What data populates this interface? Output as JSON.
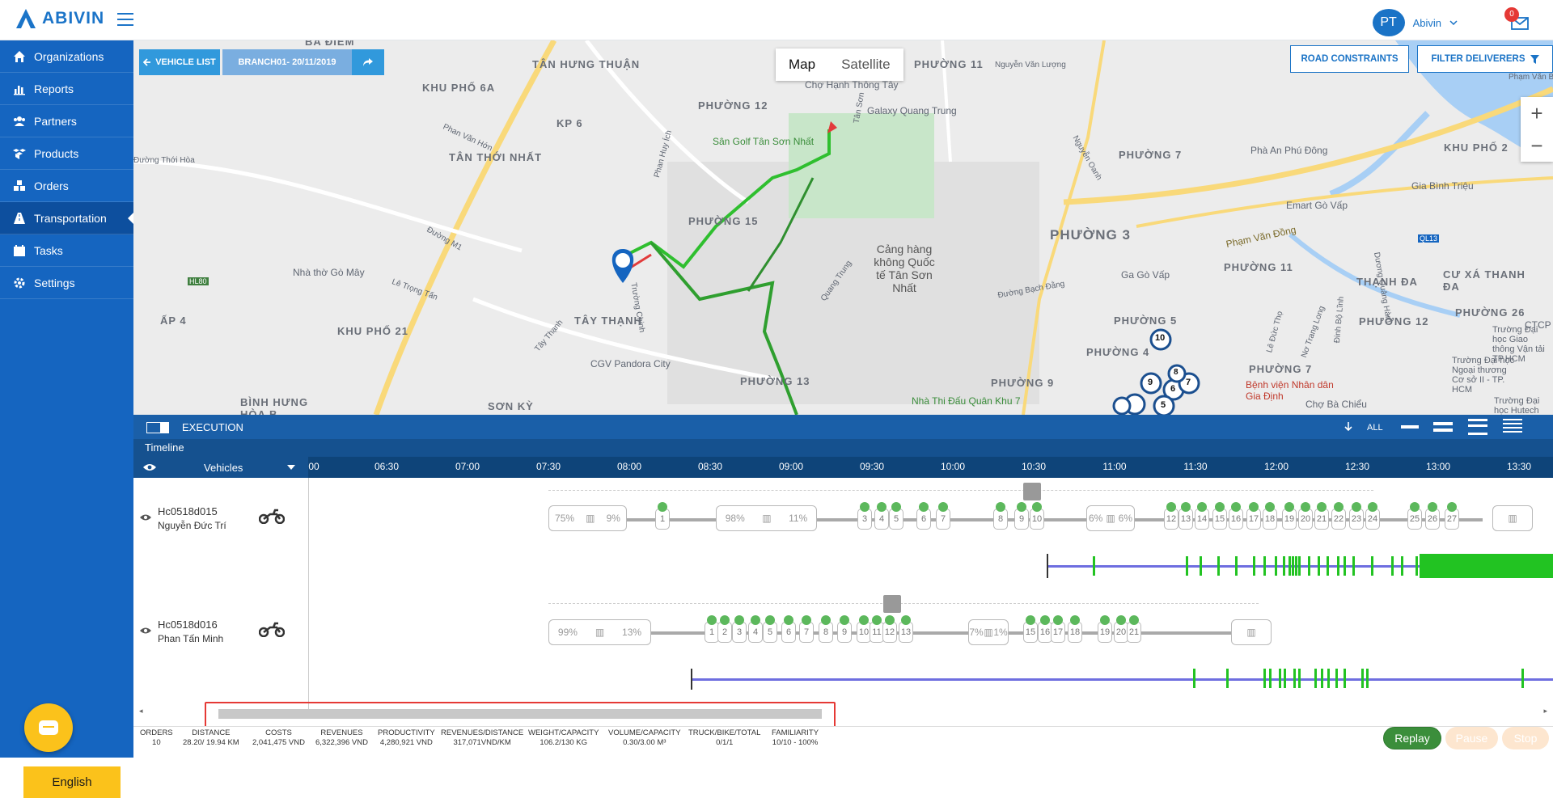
{
  "app": {
    "logo_text": "ABIVIN"
  },
  "topbar": {
    "avatar_initials": "PT",
    "user_name": "Abivin",
    "notification_count": "0"
  },
  "sidebar": {
    "items": [
      {
        "label": "Organizations",
        "icon": "home-icon"
      },
      {
        "label": "Reports",
        "icon": "bar-chart-icon"
      },
      {
        "label": "Partners",
        "icon": "users-icon"
      },
      {
        "label": "Products",
        "icon": "boxes-icon"
      },
      {
        "label": "Orders",
        "icon": "cubes-icon"
      },
      {
        "label": "Transportation",
        "icon": "road-icon",
        "active": true
      },
      {
        "label": "Tasks",
        "icon": "calendar-icon"
      },
      {
        "label": "Settings",
        "icon": "gear-icon"
      }
    ],
    "language": "English"
  },
  "map": {
    "vehicle_list_label": "VEHICLE LIST",
    "branch_label": "BRANCH01- 20/11/2019",
    "map_type_map": "Map",
    "map_type_satellite": "Satellite",
    "road_constraints_label": "ROAD CONSTRAINTS",
    "filter_deliverers_label": "FILTER DELIVERERS",
    "zoom_in": "+",
    "zoom_out": "−",
    "labels": [
      "BA ĐIỂM",
      "TÂN HƯNG THUẬN",
      "KHU PHỐ 6A",
      "KP 6",
      "TÂN THỚI NHẤT",
      "PHƯỜNG 12",
      "PHƯỜNG 15",
      "Sân Golf Tân Sơn Nhất",
      "Chợ Hạnh Thông Tây",
      "Galaxy Quang Trung",
      "PHƯỜNG 11",
      "PHƯỜNG 7",
      "Phà An Phú Đông",
      "KHU PHỐ 2",
      "Gia Bình Triệu",
      "Emart Gò Vấp",
      "PHƯỜNG 3",
      "Cảng hàng không Quốc tế Tân Sơn Nhất",
      "Phạm Văn Đồng",
      "Ga Gò Vấp",
      "PHƯỜNG 11",
      "THẠNH ĐA",
      "CƯ XÁ THANH ĐA",
      "Nhà thờ Gò Mây",
      "ẤP 4",
      "KHU PHỐ 21",
      "TÂY THẠNH",
      "CGV Pandora City",
      "PHƯỜNG 13",
      "PHƯỜNG 5",
      "PHƯỜNG 12",
      "PHƯỜNG 26",
      "PHƯỜNG 4",
      "PHƯỜNG 9",
      "PHƯỜNG 7",
      "Bệnh viện Nhân dân Gia Định",
      "Nhà Thi Đấu Quân Khu 7",
      "Chợ Bà Chiểu",
      "BÌNH HƯNG HÒA B",
      "SƠN KỲ",
      "Trường Đại học Ngoại thương Cơ sở II - TP. HCM",
      "Trường Đại học Giao thông Vận tải TP.HCM",
      "Trường Đại học Hutech",
      "CTCP",
      "Đường M1",
      "Đường Thới Hòa",
      "Phan Văn Hớn",
      "Lê Trọng Tấn",
      "Tây Thạnh",
      "Đường Bạch Đằng",
      "Nguyễn Văn Lượng",
      "Phạm Văn Bạch",
      "Trường Chinh",
      "Tân Sơn",
      "Phan Huy Ích",
      "Quang Trung",
      "Nguyễn Oanh",
      "Lê Đức Thọ",
      "HL80",
      "QL13",
      "Nơ Trang Long",
      "Đinh Bộ Lĩnh",
      "Dương Quảng Hàm"
    ],
    "markers": [
      "10",
      "9",
      "6",
      "5",
      "7",
      "8",
      "4",
      "5"
    ]
  },
  "execution": {
    "title": "EXECUTION",
    "all_label": "ALL"
  },
  "timeline": {
    "title": "Timeline",
    "vehicles_label": "Vehicles",
    "ticks": [
      "00",
      "06:30",
      "07:00",
      "07:30",
      "08:00",
      "08:30",
      "09:00",
      "09:30",
      "10:00",
      "10:30",
      "11:00",
      "11:30",
      "12:00",
      "12:30",
      "13:00",
      "13:30"
    ],
    "rows": [
      {
        "id": "Hc0518d015",
        "driver": "Nguyễn Đức Trí",
        "depot_start": {
          "left": "75%",
          "right": "9%"
        },
        "depot_mid1": {
          "left": "98%",
          "right": "11%"
        },
        "depot_mid2": {
          "left": "6%",
          "right": "6%"
        },
        "stops": [
          "1",
          "3",
          "4",
          "5",
          "6",
          "7",
          "8",
          "9",
          "10",
          "12",
          "13",
          "14",
          "15",
          "16",
          "17",
          "18",
          "19",
          "20",
          "21",
          "22",
          "23",
          "24",
          "25",
          "26",
          "27"
        ]
      },
      {
        "id": "Hc0518d016",
        "driver": "Phan Tấn Minh",
        "depot_start": {
          "left": "99%",
          "right": "13%"
        },
        "depot_mid1": {
          "left": "7%",
          "right": "1%"
        },
        "stops": [
          "1",
          "2",
          "3",
          "4",
          "5",
          "6",
          "7",
          "8",
          "9",
          "10",
          "11",
          "12",
          "13",
          "15",
          "16",
          "17",
          "18",
          "19",
          "20",
          "21"
        ]
      }
    ]
  },
  "stats": [
    {
      "label": "ORDERS",
      "value": "10"
    },
    {
      "label": "DISTANCE",
      "value": "28.20/ 19.94 KM"
    },
    {
      "label": "COSTS",
      "value": "2,041,475 VND"
    },
    {
      "label": "REVENUES",
      "value": "6,322,396 VND"
    },
    {
      "label": "PRODUCTIVITY",
      "value": "4,280,921 VND"
    },
    {
      "label": "REVENUES/DISTANCE",
      "value": "317,071VND/KM"
    },
    {
      "label": "WEIGHT/CAPACITY",
      "value": "106.2/130 KG"
    },
    {
      "label": "VOLUME/CAPACITY",
      "value": "0.30/3.00 M³"
    },
    {
      "label": "TRUCK/BIKE/TOTAL",
      "value": "0/1/1"
    },
    {
      "label": "FAMILIARITY",
      "value": "10/10 - 100%"
    }
  ],
  "controls": {
    "replay": "Replay",
    "pause": "Pause",
    "stop": "Stop"
  },
  "colors": {
    "primary": "#1565c0",
    "accent": "#fbc21b",
    "replay": "#3b8e3b",
    "route_green": "#2fbf2f"
  }
}
